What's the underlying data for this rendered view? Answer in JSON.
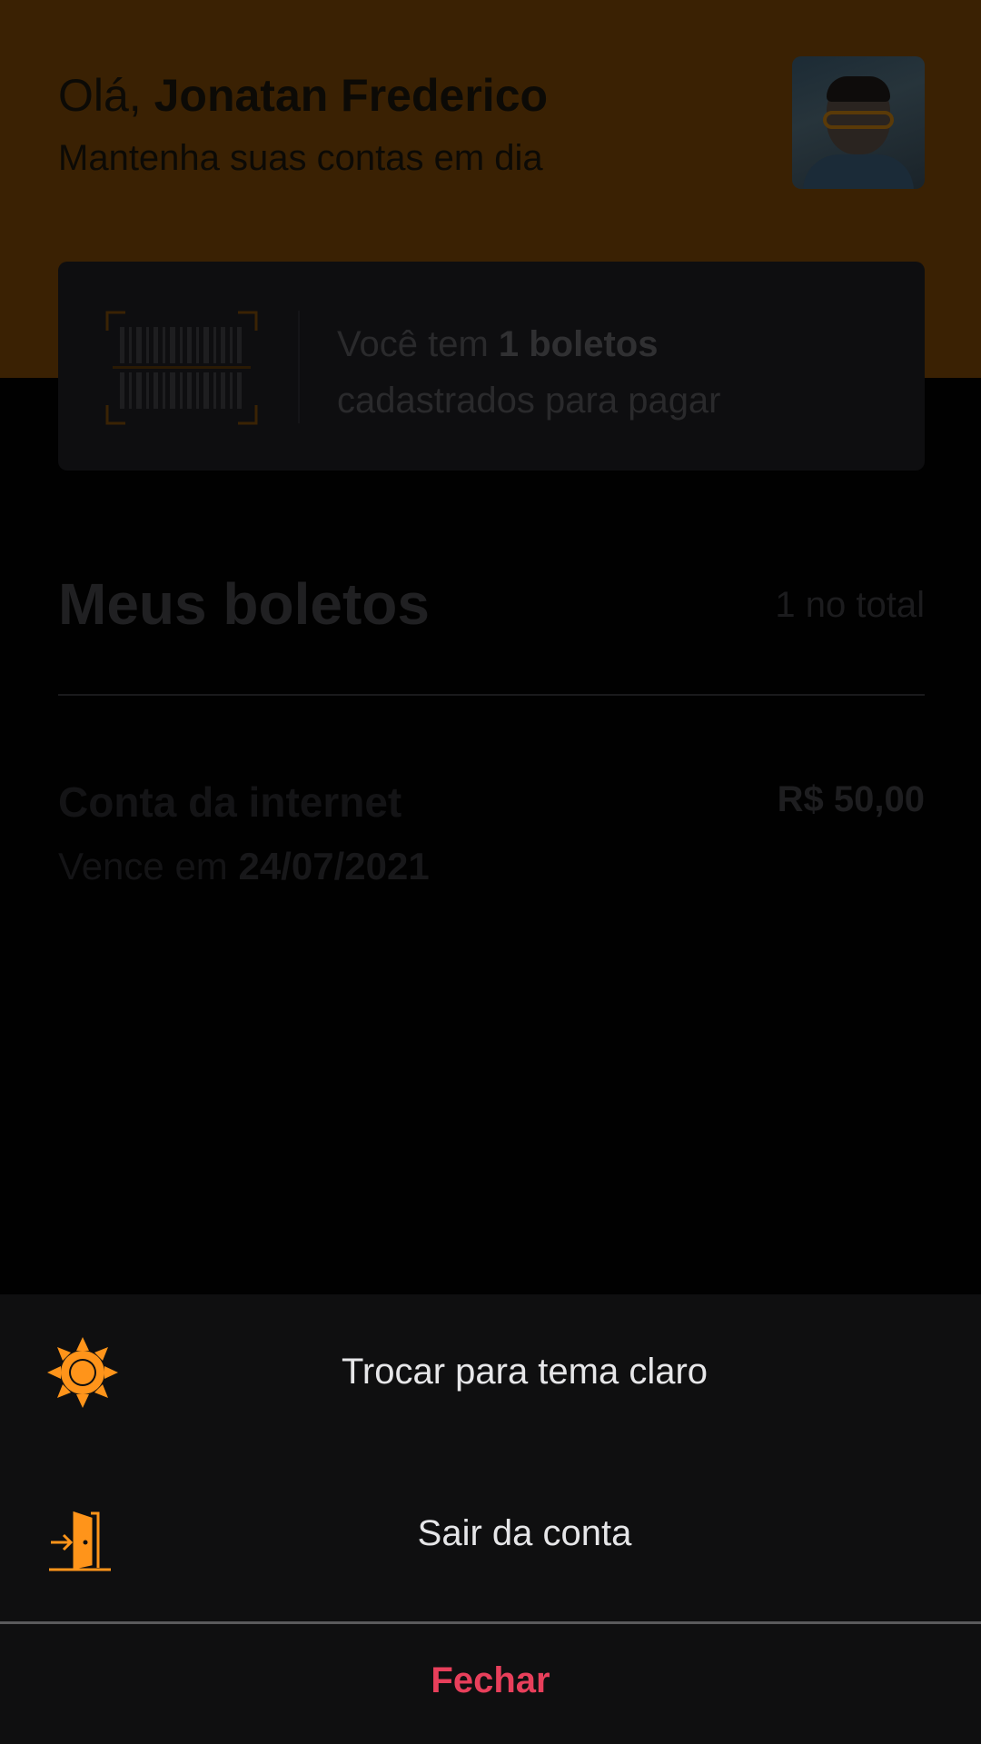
{
  "header": {
    "greeting_prefix": "Olá, ",
    "user_name": "Jonatan Frederico",
    "subtitle": "Mantenha suas contas em dia"
  },
  "boleto_card": {
    "text_prefix": "Você tem ",
    "count_text": "1 boletos",
    "text_suffix": "cadastrados para pagar"
  },
  "section": {
    "title": "Meus boletos",
    "count": "1 no total"
  },
  "bills": [
    {
      "name": "Conta da internet",
      "due_prefix": "Vence em ",
      "due_date": "24/07/2021",
      "value": "R$ 50,00"
    }
  ],
  "sheet": {
    "theme_label": "Trocar para tema claro",
    "theme_icon": "sun-icon",
    "logout_label": "Sair da conta",
    "logout_icon": "exit-door-icon",
    "close_label": "Fechar"
  },
  "colors": {
    "accent": "#FF941A",
    "close": "#E83F5B",
    "sheet_background": "#0F0F10"
  }
}
